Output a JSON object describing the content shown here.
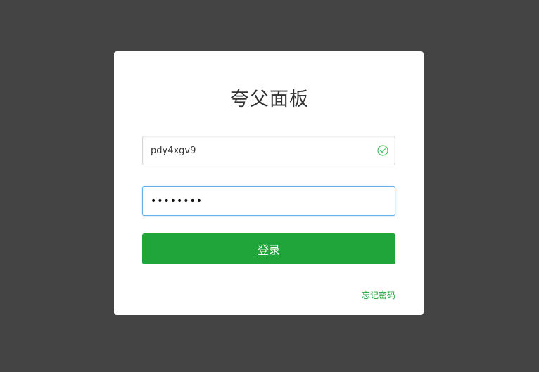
{
  "login": {
    "title": "夸父面板",
    "username": {
      "value": "pdy4xgv9",
      "valid_icon": "check-circle-icon"
    },
    "password": {
      "value": "........"
    },
    "submit_label": "登录",
    "forgot_label": "忘记密码"
  },
  "colors": {
    "background": "#444444",
    "card": "#ffffff",
    "accent": "#20a53a",
    "focus_border": "#66afe9"
  }
}
